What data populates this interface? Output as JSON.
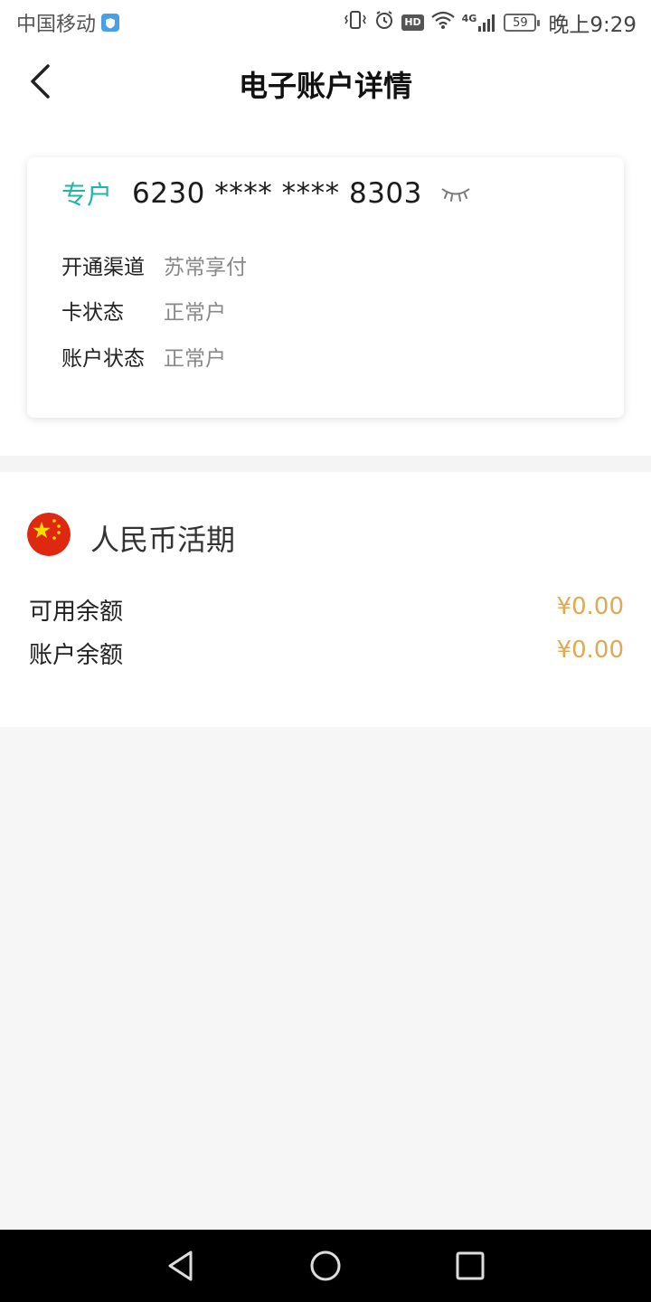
{
  "status_bar": {
    "carrier": "中国移动",
    "network": "4G",
    "battery": "59",
    "time": "晚上9:29",
    "hd_label": "HD"
  },
  "header": {
    "title": "电子账户详情"
  },
  "account_card": {
    "type_label": "专户",
    "account_number": "6230 **** **** 8303",
    "rows": [
      {
        "label": "开通渠道",
        "value": "苏常享付"
      },
      {
        "label": "卡状态",
        "value": "正常户"
      },
      {
        "label": "账户状态",
        "value": "正常户"
      }
    ]
  },
  "balance": {
    "currency_title": "人民币活期",
    "rows": [
      {
        "label": "可用余额",
        "value": "¥0.00"
      },
      {
        "label": "账户余额",
        "value": "¥0.00"
      }
    ]
  },
  "colors": {
    "accent_teal": "#1fb5a8",
    "amount_gold": "#e0a850",
    "flag_red": "#de2910",
    "flag_star": "#ffde00"
  }
}
